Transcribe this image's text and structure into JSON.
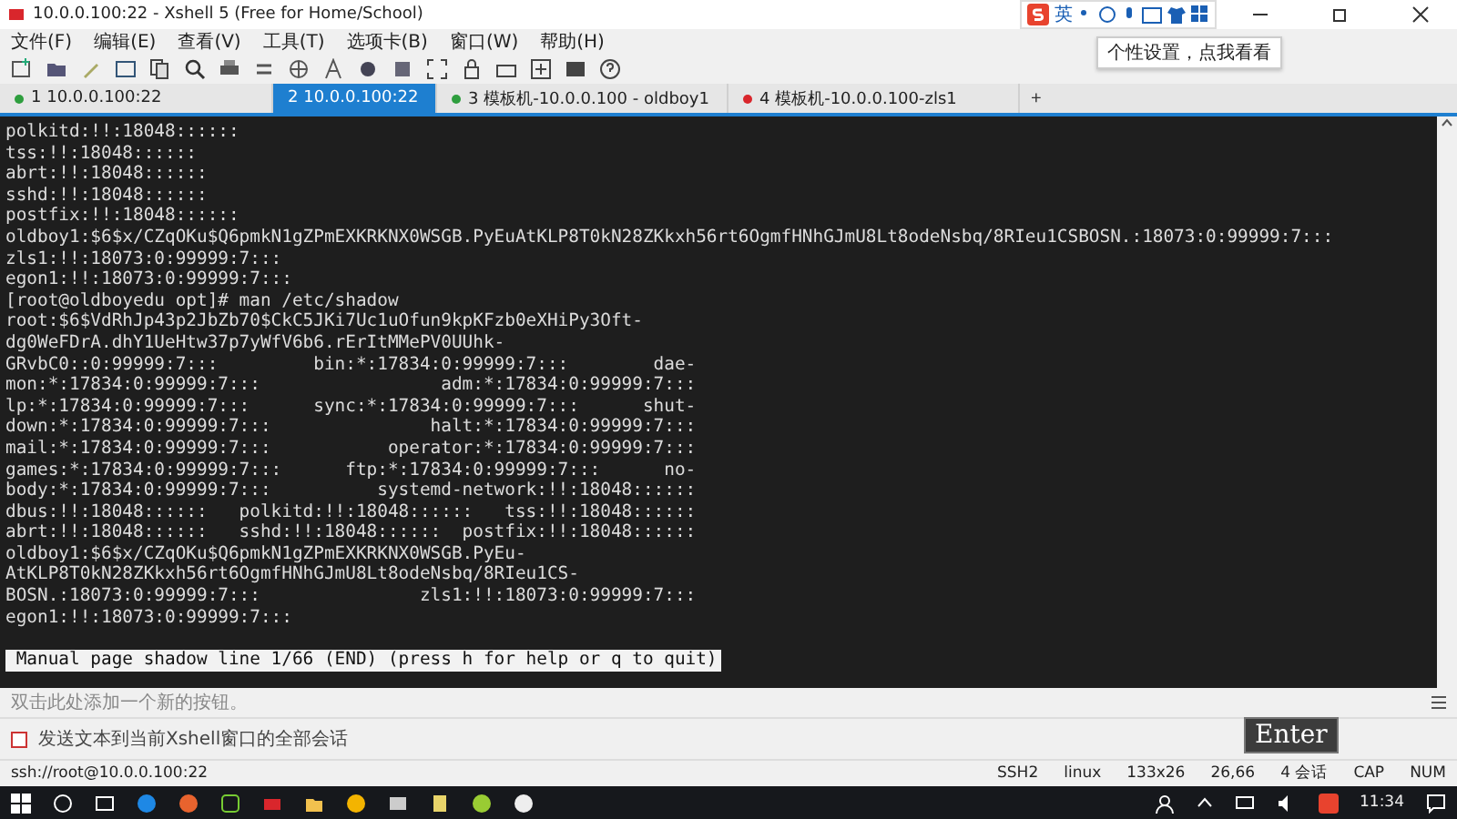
{
  "window": {
    "title": "10.0.0.100:22 - Xshell 5 (Free for Home/School)"
  },
  "ime_toolbar": {
    "mode": "英"
  },
  "tooltip": "个性设置，点我看看",
  "menu": [
    "文件(F)",
    "编辑(E)",
    "查看(V)",
    "工具(T)",
    "选项卡(B)",
    "窗口(W)",
    "帮助(H)"
  ],
  "tabs": [
    {
      "number": "1",
      "label": "10.0.0.100:22",
      "selected": false,
      "color": "#2e9e3e"
    },
    {
      "number": "2",
      "label": "10.0.0.100:22",
      "selected": true
    },
    {
      "number": "3",
      "label": "模板机-10.0.0.100 - oldboy1",
      "selected": false,
      "color": "#2e9e3e"
    },
    {
      "number": "4",
      "label": "模板机-10.0.0.100-zls1",
      "selected": false,
      "color": "#d9262c"
    }
  ],
  "new_tab_button": "+",
  "terminal": {
    "lines": [
      "polkitd:!!:18048::::::",
      "tss:!!:18048::::::",
      "abrt:!!:18048::::::",
      "sshd:!!:18048::::::",
      "postfix:!!:18048::::::",
      "oldboy1:$6$x/CZqOKu$Q6pmkN1gZPmEXKRKNX0WSGB.PyEuAtKLP8T0kN28ZKkxh56rt6OgmfHNhGJmU8Lt8odeNsbq/8RIeu1CSBOSN.:18073:0:99999:7:::",
      "zls1:!!:18073:0:99999:7:::",
      "egon1:!!:18073:0:99999:7:::",
      "[root@oldboyedu opt]# man /etc/shadow",
      "root:$6$VdRhJp43p2JbZb70$CkC5JKi7Uc1uOfun9kpKFzb0eXHiPy3Oft-",
      "dg0WeFDrA.dhY1UeHtw37p7yWfV6b6.rErItMMePV0UUhk-",
      "GRvbC0::0:99999:7:::         bin:*:17834:0:99999:7:::        dae-",
      "mon:*:17834:0:99999:7:::                 adm:*:17834:0:99999:7:::",
      "lp:*:17834:0:99999:7:::      sync:*:17834:0:99999:7:::      shut-",
      "down:*:17834:0:99999:7:::               halt:*:17834:0:99999:7:::",
      "mail:*:17834:0:99999:7:::           operator:*:17834:0:99999:7:::",
      "games:*:17834:0:99999:7:::      ftp:*:17834:0:99999:7:::      no-",
      "body:*:17834:0:99999:7:::          systemd-network:!!:18048::::::",
      "dbus:!!:18048::::::   polkitd:!!:18048::::::   tss:!!:18048::::::",
      "abrt:!!:18048::::::   sshd:!!:18048::::::  postfix:!!:18048::::::",
      "oldboy1:$6$x/CZqOKu$Q6pmkN1gZPmEXKRKNX0WSGB.PyEu-",
      "AtKLP8T0kN28ZKkxh56rt6OgmfHNhGJmU8Lt8odeNsbq/8RIeu1CS-",
      "BOSN.:18073:0:99999:7:::               zls1:!!:18073:0:99999:7:::",
      "egon1:!!:18073:0:99999:7:::"
    ],
    "pager_status": " Manual page shadow line 1/66 (END) (press h for help or q to quit)"
  },
  "quick_command_bar": {
    "hint": "双击此处添加一个新的按钮。"
  },
  "compose_bar": {
    "placeholder": "发送文本到当前Xshell窗口的全部会话"
  },
  "status_bar": {
    "address": "ssh://root@10.0.0.100:22",
    "protocol": "SSH2",
    "terminal_type": "linux",
    "size": "133x26",
    "cursor": "26,66",
    "sessions": "4 会话",
    "caps": "CAP",
    "num": "NUM"
  },
  "key_overlay": "Enter",
  "taskbar": {
    "clock": "11:34"
  }
}
